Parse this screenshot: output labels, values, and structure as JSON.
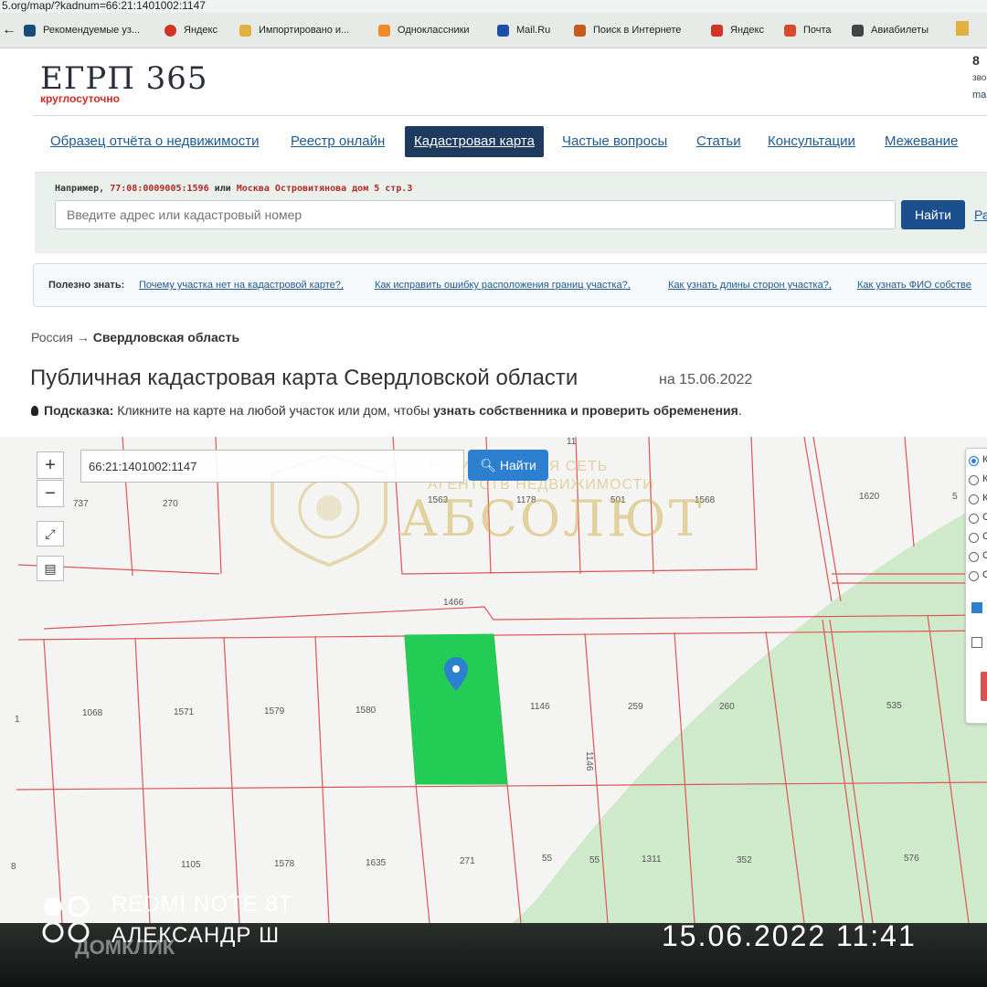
{
  "browser": {
    "url": "5.org/map/?kadnum=66:21:1401002:1147",
    "bookmarks": [
      {
        "label": "Рекомендуемые уз...",
        "color": "#1a4a7a"
      },
      {
        "label": "Яндекс",
        "color": "#d23327"
      },
      {
        "label": "Импортировано и...",
        "color": "#e0b040"
      },
      {
        "label": "Одноклассники",
        "color": "#f08a24"
      },
      {
        "label": "Mail.Ru",
        "color": "#1e4fa8"
      },
      {
        "label": "Поиск в Интернете",
        "color": "#c85a1a"
      },
      {
        "label": "Яндекс",
        "color": "#d23327"
      },
      {
        "label": "Почта",
        "color": "#d84a2c"
      },
      {
        "label": "Авиабилеты",
        "color": "#444444"
      }
    ]
  },
  "header": {
    "logo": "ЕГРП 365",
    "logo_sub": "круглосуточно",
    "right_num": "8",
    "right_text": "зво",
    "right_link": "ma"
  },
  "nav": [
    {
      "label": "Образец отчёта о недвижимости"
    },
    {
      "label": "Реестр онлайн"
    },
    {
      "label": "Кадастровая карта",
      "active": true
    },
    {
      "label": "Частые вопросы"
    },
    {
      "label": "Статьи"
    },
    {
      "label": "Консультации"
    },
    {
      "label": "Межевание"
    }
  ],
  "search": {
    "example_prefix": "Например,",
    "example_num": "77:08:0009005:1596",
    "example_or": "или",
    "example_addr": "Москва Островитянова дом 5 стр.3",
    "placeholder": "Введите адрес или кадастровый номер",
    "button": "Найти",
    "extra": "Ра"
  },
  "useful": {
    "label": "Полезно знать:",
    "links": [
      "Почему участка нет на кадастровой карте?,",
      "Как исправить ошибку расположения границ участка?,",
      "Как узнать длины сторон участка?,",
      "Как узнать ФИО собстве"
    ]
  },
  "breadcrumb": {
    "root": "Россия",
    "arrow": "→",
    "current": "Свердловская область"
  },
  "page": {
    "title": "Публичная кадастровая карта Свердловской области",
    "date": "на 15.06.2022",
    "hint_label": "Подсказка:",
    "hint_text": "Кликните на карте на любой участок или дом, чтобы",
    "hint_bold": "узнать собственника и проверить обременения",
    "hint_end": "."
  },
  "map": {
    "search_value": "66:21:1401002:1147",
    "search_button": "Найти",
    "zoom_in": "+",
    "zoom_out": "−",
    "parcel_labels": [
      "737",
      "270",
      "1563",
      "1178",
      "501",
      "1568",
      "1620",
      "1466",
      "1068",
      "1571",
      "1579",
      "1580",
      "1146",
      "259",
      "260",
      "535",
      "1105",
      "1578",
      "1635",
      "271",
      "55",
      "55",
      "1311",
      "352",
      "576",
      "8",
      "1",
      "11",
      "5"
    ],
    "rotated_label": "1146",
    "selected_parcel": "66:21:1401002:1147",
    "layer_letters": [
      "К",
      "К",
      "К",
      "С",
      "С",
      "С",
      "С"
    ],
    "colors": {
      "parcel_line": "#e05555",
      "selected": "#22cc55",
      "green_zone": "#c8e8c4"
    }
  },
  "watermark": {
    "line1": "РЕГИОНАЛЬНАЯ СЕТЬ",
    "line2": "АГЕНТСТВ НЕДВИЖИМОСТИ",
    "brand": "АБСОЛЮТ"
  },
  "photo": {
    "model": "REDMI NOTE 8T",
    "owner": "АЛЕКСАНДР Ш",
    "timestamp": "15.06.2022 11:41",
    "domclick": "ДОМКЛИК"
  }
}
